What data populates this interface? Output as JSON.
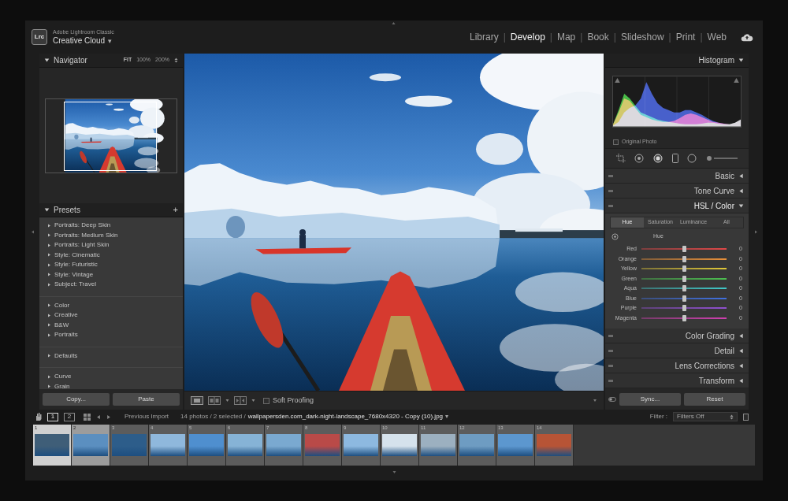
{
  "app": {
    "logo": "Lrc",
    "vendor": "Adobe Lightroom Classic",
    "product": "Creative Cloud",
    "product_menu": "▾"
  },
  "modules": {
    "separator": "|",
    "items": [
      {
        "label": "Library",
        "selected": false
      },
      {
        "label": "Develop",
        "selected": true
      },
      {
        "label": "Map",
        "selected": false
      },
      {
        "label": "Book",
        "selected": false
      },
      {
        "label": "Slideshow",
        "selected": false
      },
      {
        "label": "Print",
        "selected": false
      },
      {
        "label": "Web",
        "selected": false
      }
    ]
  },
  "navigator": {
    "title": "Navigator",
    "expanded": true,
    "zoom": [
      {
        "label": "FIT",
        "selected": true
      },
      {
        "label": "100%",
        "selected": false
      },
      {
        "label": "200%",
        "selected": false
      }
    ]
  },
  "presets": {
    "title": "Presets",
    "expanded": true,
    "add": "+",
    "groups": [
      [
        {
          "label": "Portraits: Deep Skin",
          "expanded": false
        },
        {
          "label": "Portraits: Medium Skin",
          "expanded": false
        },
        {
          "label": "Portraits: Light Skin",
          "expanded": false
        },
        {
          "label": "Style: Cinematic",
          "expanded": false
        },
        {
          "label": "Style: Futuristic",
          "expanded": false
        },
        {
          "label": "Style: Vintage",
          "expanded": false
        },
        {
          "label": "Subject: Travel",
          "expanded": false
        }
      ],
      [
        {
          "label": "Color",
          "expanded": false
        },
        {
          "label": "Creative",
          "expanded": false
        },
        {
          "label": "B&W",
          "expanded": false
        },
        {
          "label": "Portraits",
          "expanded": false
        }
      ],
      [
        {
          "label": "Defaults",
          "expanded": false
        }
      ],
      [
        {
          "label": "Curve",
          "expanded": false
        },
        {
          "label": "Grain",
          "expanded": false
        }
      ]
    ]
  },
  "left_buttons": [
    "Copy...",
    "Paste"
  ],
  "toolbar": {
    "soft_proofing": {
      "label": "Soft Proofing",
      "checked": false
    }
  },
  "histogram": {
    "title": "Histogram",
    "expanded": true,
    "series": [
      {
        "color": "#e23b3b",
        "values": [
          5,
          30,
          60,
          55,
          40,
          25,
          20,
          15,
          12,
          10,
          10,
          12,
          18,
          25,
          28,
          25,
          20,
          15,
          10,
          8,
          6,
          5,
          8,
          15
        ]
      },
      {
        "color": "#3bd23b",
        "values": [
          5,
          35,
          70,
          60,
          45,
          30,
          25,
          20,
          15,
          12,
          10,
          8,
          6,
          5,
          5,
          5,
          6,
          8,
          8,
          6,
          5,
          5,
          8,
          15
        ]
      },
      {
        "color": "#3b5be8",
        "values": [
          2,
          10,
          30,
          40,
          45,
          60,
          95,
          70,
          50,
          40,
          35,
          30,
          30,
          35,
          35,
          30,
          25,
          18,
          12,
          8,
          6,
          5,
          8,
          15
        ]
      }
    ],
    "original_photo": {
      "label": "Original Photo",
      "checked": false
    }
  },
  "panels": [
    {
      "title": "Basic",
      "expanded": false
    },
    {
      "title": "Tone Curve",
      "expanded": false
    },
    {
      "title": "HSL / Color",
      "expanded": true
    },
    {
      "title": "Color Grading",
      "expanded": false
    },
    {
      "title": "Detail",
      "expanded": false
    },
    {
      "title": "Lens Corrections",
      "expanded": false
    },
    {
      "title": "Transform",
      "expanded": false
    }
  ],
  "hsl": {
    "tabs": [
      {
        "label": "Hue",
        "selected": true
      },
      {
        "label": "Saturation",
        "selected": false
      },
      {
        "label": "Luminance",
        "selected": false
      },
      {
        "label": "All",
        "selected": false
      }
    ],
    "group": "Hue",
    "sliders": [
      {
        "name": "Red",
        "value": "0",
        "level": 0.5,
        "color": "#e04848"
      },
      {
        "name": "Orange",
        "value": "0",
        "level": 0.5,
        "color": "#e8903a"
      },
      {
        "name": "Yellow",
        "value": "0",
        "level": 0.5,
        "color": "#e0c838"
      },
      {
        "name": "Green",
        "value": "0",
        "level": 0.5,
        "color": "#4cc050"
      },
      {
        "name": "Aqua",
        "value": "0",
        "level": 0.5,
        "color": "#40c8c8"
      },
      {
        "name": "Blue",
        "value": "0",
        "level": 0.5,
        "color": "#4070e0"
      },
      {
        "name": "Purple",
        "value": "0",
        "level": 0.5,
        "color": "#9050d0"
      },
      {
        "name": "Magenta",
        "value": "0",
        "level": 0.5,
        "color": "#d040b0"
      }
    ]
  },
  "right_buttons": [
    "Sync...",
    "Reset"
  ],
  "filmstrip": {
    "screens": [
      {
        "label": "1",
        "selected": true
      },
      {
        "label": "2",
        "selected": false
      }
    ],
    "source": "Previous Import",
    "summary": "14 photos / 2 selected /",
    "filename": "wallpapersden.com_dark-night-landscape_7680x4320 - Copy (10).jpg",
    "filename_menu": "▾",
    "filter_label": "Filter :",
    "filter_value": "Filters Off",
    "thumbnails": [
      {
        "number": "1",
        "selected": true,
        "active": true,
        "color": "#3f5e78"
      },
      {
        "number": "2",
        "selected": true,
        "active": false,
        "color": "#5b8fc0"
      },
      {
        "number": "3",
        "selected": false,
        "active": false,
        "color": "#2d5d8a"
      },
      {
        "number": "4",
        "selected": false,
        "active": false,
        "color": "#8fb8dc"
      },
      {
        "number": "5",
        "selected": false,
        "active": false,
        "color": "#4f8fcf"
      },
      {
        "number": "6",
        "selected": false,
        "active": false,
        "color": "#86b3d6"
      },
      {
        "number": "7",
        "selected": false,
        "active": false,
        "color": "#7aa9d0"
      },
      {
        "number": "8",
        "selected": false,
        "active": false,
        "color": "#b94a48"
      },
      {
        "number": "9",
        "selected": false,
        "active": false,
        "color": "#8db9e0"
      },
      {
        "number": "10",
        "selected": false,
        "active": false,
        "color": "#d5e2ec"
      },
      {
        "number": "11",
        "selected": false,
        "active": false,
        "color": "#9cb0c0"
      },
      {
        "number": "12",
        "selected": false,
        "active": false,
        "color": "#6e9cc2"
      },
      {
        "number": "13",
        "selected": false,
        "active": false,
        "color": "#5c97cf"
      },
      {
        "number": "14",
        "selected": false,
        "active": false,
        "color": "#b75436"
      }
    ]
  }
}
